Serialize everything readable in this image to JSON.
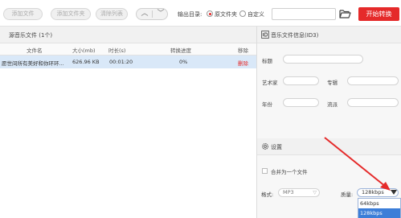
{
  "toolbar": {
    "add_file": "添加文件",
    "add_folder": "添加文件夹",
    "clear_list": "清除列表",
    "output_dir_label": "输出目录:",
    "radio_source": "原文件夹",
    "radio_custom": "自定义",
    "output_path": "",
    "start_button": "开始转换",
    "selected_output": "原文件夹"
  },
  "left": {
    "header": "源音乐文件 (1个)",
    "columns": [
      "文件名",
      "大小(mb)",
      "时长(s)",
      "转换进度",
      "移除"
    ],
    "rows": [
      {
        "name": "愿世间所有美好和你环环...",
        "size": "626.96 KB",
        "duration": "00:01:20",
        "progress": "0%",
        "remove": "删除"
      }
    ]
  },
  "id3": {
    "header": "音乐文件信息(ID3)",
    "title_label": "标题",
    "artist_label": "艺术家",
    "album_label": "专辑",
    "year_label": "年份",
    "genre_label": "流派",
    "title_value": "",
    "artist_value": "",
    "album_value": "",
    "year_value": "",
    "genre_value": ""
  },
  "settings": {
    "header": "设置",
    "merge_label": "合并为一个文件",
    "merge_checked": false,
    "format_label": "格式:",
    "format_value": "MP3",
    "quality_label": "质量:",
    "quality_value": "128kbps",
    "quality_options": [
      "64kbps",
      "128kbps"
    ],
    "quality_highlighted": "128kbps"
  },
  "colors": {
    "accent": "#e52a2a",
    "selection": "#d9e8f8",
    "dropdown_highlight": "#3c7ed8"
  }
}
